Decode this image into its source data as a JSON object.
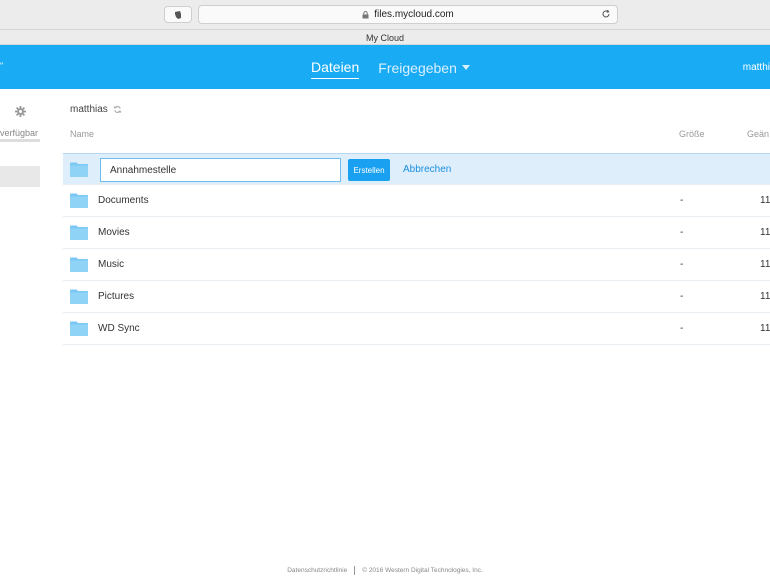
{
  "browser": {
    "url": "files.mycloud.com",
    "tab_title": "My Cloud"
  },
  "header": {
    "menu_stub": "\"",
    "tabs": [
      {
        "label": "Dateien",
        "active": true
      },
      {
        "label": "Freigegeben",
        "active": false
      }
    ],
    "user": "matthi"
  },
  "sidebar": {
    "storage_text": "verfügbar"
  },
  "breadcrumb": {
    "path": "matthias"
  },
  "columns": {
    "name": "Name",
    "size": "Größe",
    "modified": "Geän"
  },
  "new_folder": {
    "value": "Annahmestelle",
    "create_label": "Erstellen",
    "cancel_label": "Abbrechen"
  },
  "files": [
    {
      "name": "Documents",
      "size": "-",
      "modified": "11"
    },
    {
      "name": "Movies",
      "size": "-",
      "modified": "11"
    },
    {
      "name": "Music",
      "size": "-",
      "modified": "11"
    },
    {
      "name": "Pictures",
      "size": "-",
      "modified": "11"
    },
    {
      "name": "WD Sync",
      "size": "-",
      "modified": "11"
    }
  ],
  "footer": {
    "privacy": "Datenschutzrichtlinie",
    "copyright": "© 2016 Western Digital Technologies, Inc."
  },
  "colors": {
    "brand": "#1aabf5",
    "folder": "#7cc8f4",
    "selected_row": "#dfeefb"
  }
}
